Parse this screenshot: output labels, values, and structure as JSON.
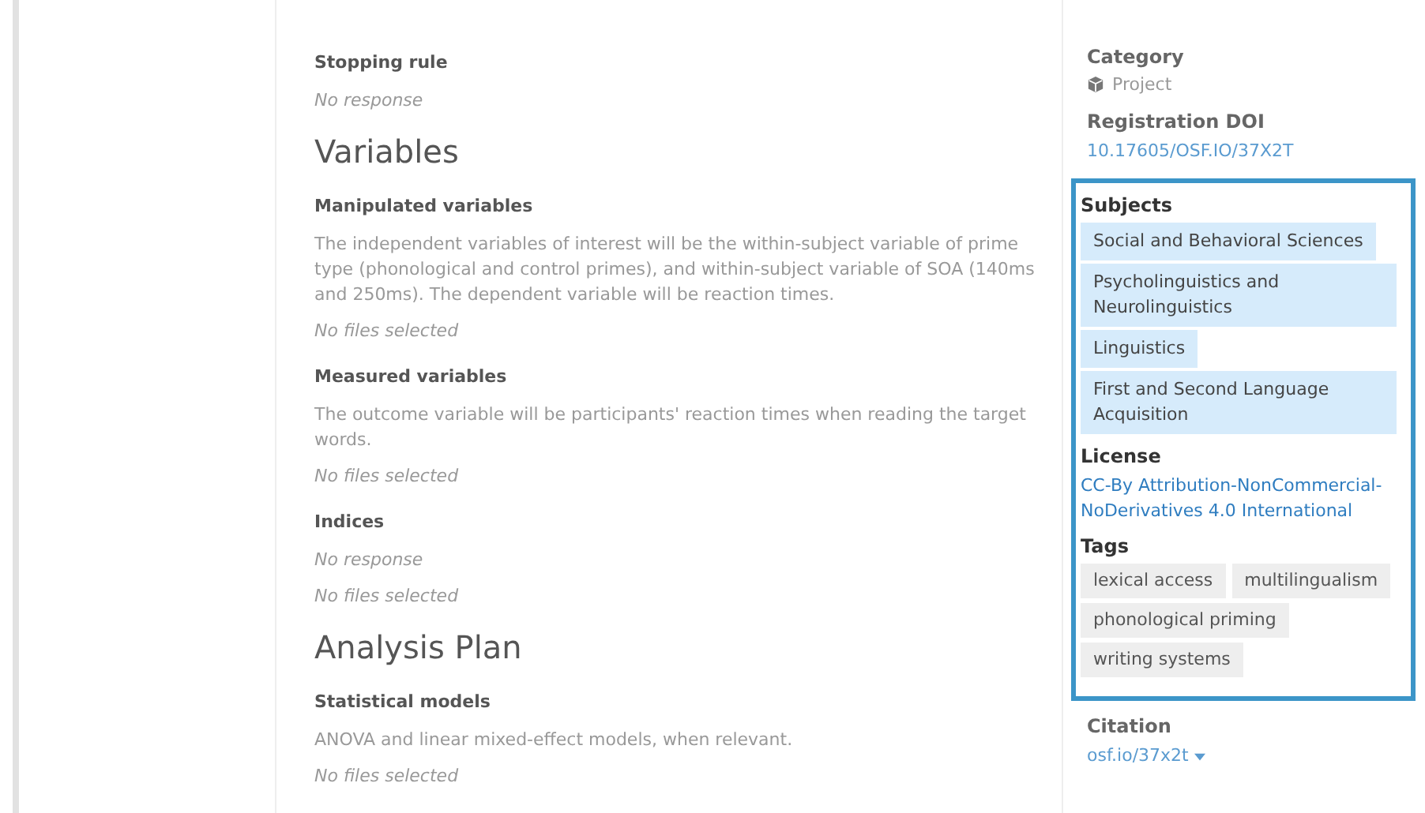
{
  "main": [
    {
      "kind": "question",
      "label": "Stopping rule",
      "lines": [
        {
          "kind": "empty",
          "text": "No response"
        }
      ]
    },
    {
      "kind": "heading",
      "text": "Variables"
    },
    {
      "kind": "question",
      "label": "Manipulated variables",
      "lines": [
        {
          "kind": "answer",
          "text": "The independent variables of interest will be the within-subject variable of prime type (phonological and control primes), and within-subject variable of SOA (140ms and 250ms). The dependent variable will be reaction times."
        },
        {
          "kind": "empty",
          "text": "No files selected"
        }
      ]
    },
    {
      "kind": "question",
      "label": "Measured variables",
      "lines": [
        {
          "kind": "answer",
          "text": "The outcome variable will be participants' reaction times when reading the target words."
        },
        {
          "kind": "empty",
          "text": "No files selected"
        }
      ]
    },
    {
      "kind": "question",
      "label": "Indices",
      "lines": [
        {
          "kind": "empty",
          "text": "No response"
        },
        {
          "kind": "empty",
          "text": "No files selected"
        }
      ]
    },
    {
      "kind": "heading",
      "text": "Analysis Plan"
    },
    {
      "kind": "question",
      "label": "Statistical models",
      "lines": [
        {
          "kind": "answer",
          "text": "ANOVA and linear mixed-effect models, when relevant."
        },
        {
          "kind": "empty",
          "text": "No files selected"
        }
      ]
    }
  ],
  "sidebar": {
    "category": {
      "label": "Category",
      "value": "Project"
    },
    "doi": {
      "label": "Registration DOI",
      "value": "10.17605/OSF.IO/37X2T"
    },
    "highlight": {
      "subjects": {
        "label": "Subjects",
        "items": [
          "Social and Behavioral Sciences",
          "Psycholinguistics and Neurolinguistics",
          "Linguistics",
          "First and Second Language Acquisition"
        ]
      },
      "license": {
        "label": "License",
        "value": "CC-By Attribution-NonCommercial-NoDerivatives 4.0 International"
      },
      "tags": {
        "label": "Tags",
        "items": [
          "lexical access",
          "multilingualism",
          "phonological priming",
          "writing systems"
        ]
      }
    },
    "citation": {
      "label": "Citation",
      "value": "osf.io/37x2t"
    }
  }
}
